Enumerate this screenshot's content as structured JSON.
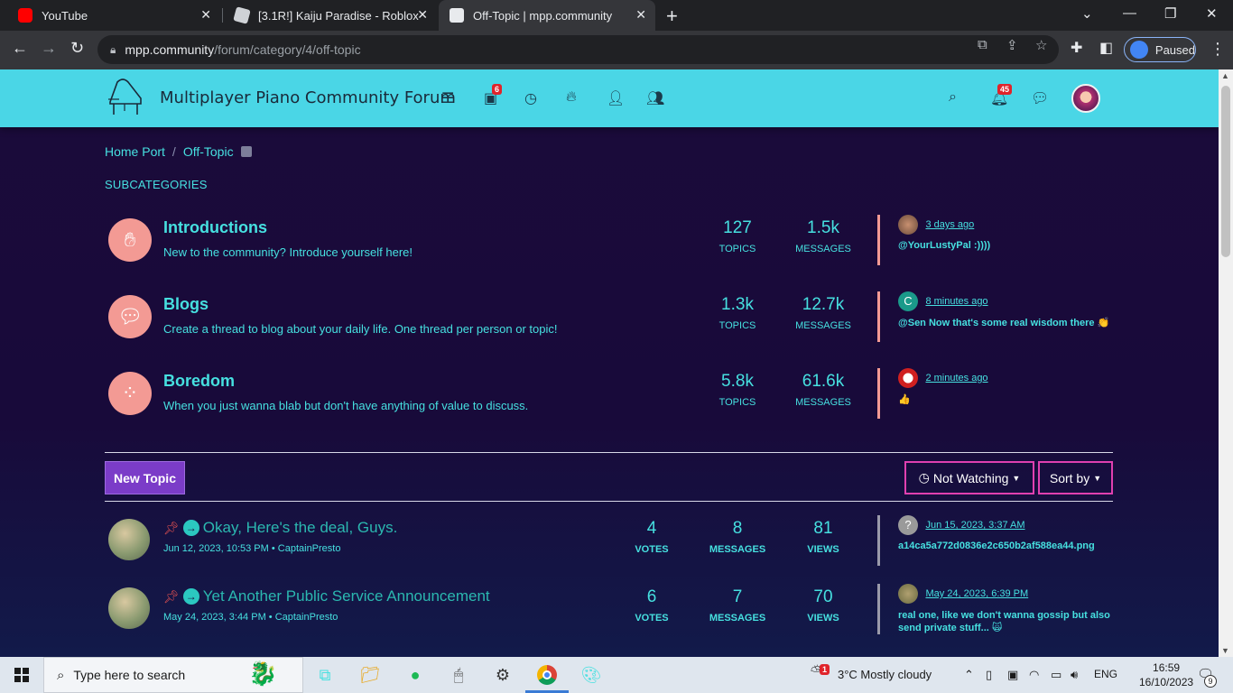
{
  "browser": {
    "tabs": [
      {
        "title": "YouTube",
        "favicon": "youtube-icon",
        "active": false
      },
      {
        "title": "[3.1R!] Kaiju Paradise - Roblox",
        "favicon": "roblox-icon",
        "active": false
      },
      {
        "title": "Off-Topic | mpp.community",
        "favicon": "mpp-icon",
        "active": true
      }
    ],
    "url_host": "mpp.community",
    "url_path": "/forum/category/4/off-topic",
    "profile_label": "Paused"
  },
  "header": {
    "site_title": "Multiplayer Piano Community Forum",
    "unread_badge": "6",
    "notifications_badge": "45",
    "accent_color": "#4ad6e6"
  },
  "breadcrumb": {
    "home": "Home Port",
    "current": "Off-Topic"
  },
  "subcategories_heading": "SUBCATEGORIES",
  "categories": [
    {
      "name": "Introductions",
      "description": "New to the community? Introduce yourself here!",
      "topics": "127",
      "topics_label": "TOPICS",
      "messages": "1.5k",
      "messages_label": "MESSAGES",
      "last_when": "3 days ago",
      "last_message": "@YourLustyPal :))))",
      "icon": "hand-icon"
    },
    {
      "name": "Blogs",
      "description": "Create a thread to blog about your daily life. One thread per person or topic!",
      "topics": "1.3k",
      "topics_label": "TOPICS",
      "messages": "12.7k",
      "messages_label": "MESSAGES",
      "last_when": "8 minutes ago",
      "last_message": "@Sen Now that's some real wisdom there 👏",
      "last_avatar_letter": "C",
      "icon": "chat-bubble-icon"
    },
    {
      "name": "Boredom",
      "description": "When you just wanna blab but don't have anything of value to discuss.",
      "topics": "5.8k",
      "topics_label": "TOPICS",
      "messages": "61.6k",
      "messages_label": "MESSAGES",
      "last_when": "2 minutes ago",
      "last_message": "👍",
      "icon": "spinner-icon"
    }
  ],
  "toolbar": {
    "new_topic": "New Topic",
    "watch": "Not Watching",
    "sort": "Sort by"
  },
  "topics": [
    {
      "title": "Okay, Here's the deal, Guys.",
      "meta": "Jun 12, 2023, 10:53 PM • CaptainPresto",
      "votes": "4",
      "votes_label": "VOTES",
      "messages": "8",
      "messages_label": "MESSAGES",
      "views": "81",
      "views_label": "VIEWS",
      "last_when": "Jun 15, 2023, 3:37 AM",
      "last_message": "a14ca5a772d0836e2c650b2af588ea44.png",
      "last_avatar_letter": "?"
    },
    {
      "title": "Yet Another Public Service Announcement",
      "meta": "May 24, 2023, 3:44 PM • CaptainPresto",
      "votes": "6",
      "votes_label": "VOTES",
      "messages": "7",
      "messages_label": "MESSAGES",
      "views": "70",
      "views_label": "VIEWS",
      "last_when": "May 24, 2023, 6:39 PM",
      "last_message": "real one, like we don't wanna gossip but also send private stuff... 🙀"
    }
  ],
  "taskbar": {
    "search_placeholder": "Type here to search",
    "weather": "3°C  Mostly cloudy",
    "weather_badge": "1",
    "language": "ENG",
    "time": "16:59",
    "date": "16/10/2023",
    "notif_count": "9"
  }
}
